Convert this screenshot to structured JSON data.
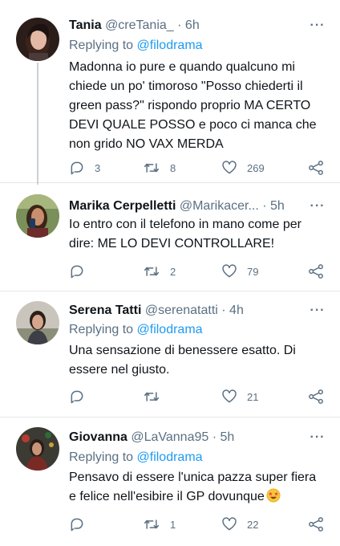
{
  "tweets": [
    {
      "name": "Tania",
      "handle": "@creTania_",
      "dot": "·",
      "time": "6h",
      "reply_prefix": "Replying to",
      "reply_mention": "@filodrama",
      "lines": [
        "Madonna io pure e quando qualcuno mi",
        "chiede un po' timoroso \"Posso chiederti il",
        "green pass?\" rispondo proprio MA CERTO",
        "DEVI QUALE POSSO e poco ci manca che",
        "non grido NO VAX MERDA"
      ],
      "replies": "3",
      "retweets": "8",
      "likes": "269"
    },
    {
      "name": "Marika Cerpelletti",
      "handle": "@Marikacer...",
      "dot": "·",
      "time": "5h",
      "lines": [
        "Io entro con il telefono in mano come per",
        "dire: ME LO DEVI CONTROLLARE!"
      ],
      "replies": "",
      "retweets": "2",
      "likes": "79"
    },
    {
      "name": "Serena Tatti",
      "handle": "@serenatatti",
      "dot": "·",
      "time": "4h",
      "reply_prefix": "Replying to",
      "reply_mention": "@filodrama",
      "lines": [
        "Una sensazione di benessere esatto. Di",
        "essere nel giusto."
      ],
      "replies": "",
      "retweets": "",
      "likes": "21"
    },
    {
      "name": "Giovanna",
      "handle": "@LaVanna95",
      "dot": "·",
      "time": "5h",
      "reply_prefix": "Replying to",
      "reply_mention": "@filodrama",
      "lines": [
        "Pensavo di essere l'unica pazza super fiera",
        "e felice nell'esibire il GP dovunque"
      ],
      "emoji": "star-struck-emoji",
      "replies": "",
      "retweets": "1",
      "likes": "22"
    }
  ],
  "icons": {
    "reply": "reply-icon",
    "retweet": "retweet-icon",
    "like": "like-icon",
    "share": "share-icon",
    "more": "more-icon"
  },
  "colors": {
    "text": "#0f1419",
    "secondary": "#5b7083",
    "link": "#1d9bf0",
    "divider": "#e6e6e6"
  }
}
